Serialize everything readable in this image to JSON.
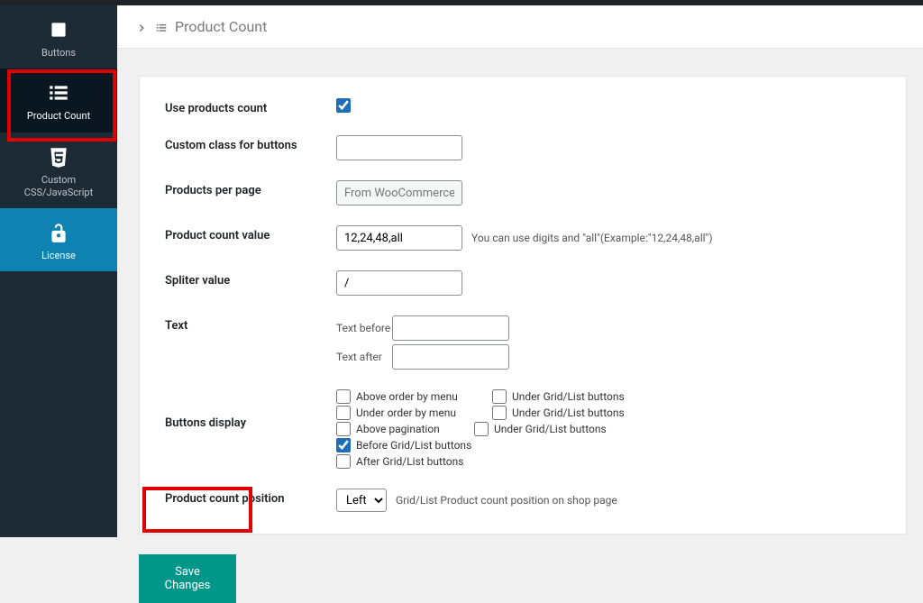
{
  "sidebar": {
    "items": [
      {
        "label": "Buttons"
      },
      {
        "label": "Product Count"
      },
      {
        "label": "Custom CSS/JavaScript"
      },
      {
        "label": "License"
      }
    ]
  },
  "header": {
    "title": "Product Count"
  },
  "fields": {
    "use_count": {
      "label": "Use products count",
      "checked": true
    },
    "custom_class": {
      "label": "Custom class for buttons",
      "value": ""
    },
    "per_page": {
      "label": "Products per page",
      "placeholder": "From WooCommerce"
    },
    "count_value": {
      "label": "Product count value",
      "value": "12,24,48,all",
      "hint": "You can use digits and \"all\"(Example:\"12,24,48,all\")"
    },
    "splitter": {
      "label": "Spliter value",
      "value": "/"
    },
    "text": {
      "label": "Text",
      "before_label": "Text before",
      "after_label": "Text after"
    },
    "display": {
      "label": "Buttons display",
      "options": [
        "Above order by menu",
        "Under Grid/List buttons",
        "Under order by menu",
        "Under Grid/List buttons",
        "Above pagination",
        "Under Grid/List buttons",
        "Before Grid/List buttons",
        "After Grid/List buttons"
      ]
    },
    "position": {
      "label": "Product count position",
      "value": "Left",
      "hint": "Grid/List Product count position on shop page"
    }
  },
  "actions": {
    "save": "Save Changes"
  }
}
